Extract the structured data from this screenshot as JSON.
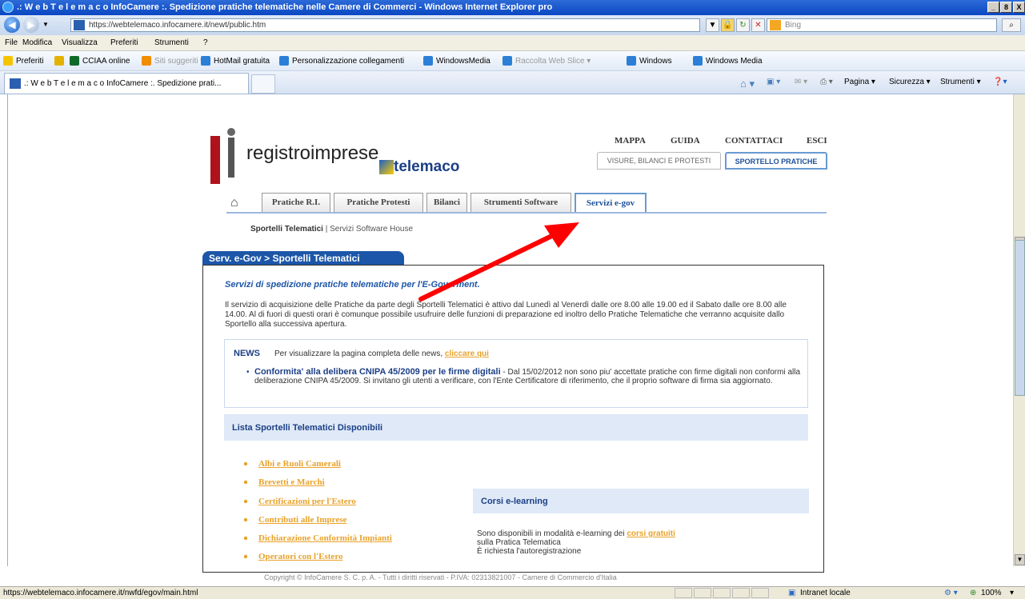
{
  "window": {
    "title": ".: W e b T e l e m a c o InfoCamere :. Spedizione pratiche telematiche nelle Camere di Commerci - Windows Internet Explorer pro",
    "min": "_",
    "max": "8",
    "close": "X"
  },
  "address": {
    "url": "https://webtelemaco.infocamere.it/newt/public.htm",
    "search_placeholder": "Bing"
  },
  "menu": {
    "file": "File",
    "edit": "Modifica",
    "view": "Visualizza",
    "favorites": "Preferiti",
    "tools": "Strumenti",
    "help": "?"
  },
  "favbar": {
    "favorites": "Preferiti",
    "items": [
      "CCIAA online",
      "Siti suggeriti ▾",
      "HotMail gratuita",
      "Personalizzazione collegamenti",
      "WindowsMedia",
      "Raccolta Web Slice ▾",
      "Windows",
      "Windows Media"
    ]
  },
  "tab": {
    "title": ".: W e b T e l e m a c o InfoCamere :. Spedizione prati..."
  },
  "commandbar": {
    "page": "Pagina ▾",
    "security": "Sicurezza ▾",
    "tools": "Strumenti ▾"
  },
  "brand": {
    "logo": "registroimprese",
    "sub": "telemaco"
  },
  "toplinks": [
    "MAPPA",
    "GUIDA",
    "CONTATTACI",
    "ESCI"
  ],
  "portal_buttons": [
    "VISURE, BILANCI E PROTESTI",
    "SPORTELLO PRATICHE"
  ],
  "nav_tabs": [
    "Pratiche R.I.",
    "Pratiche Protesti",
    "Bilanci",
    "Strumenti Software",
    "Servizi e-gov"
  ],
  "subnav": {
    "active": "Sportelli Telematici",
    "sep": " | ",
    "other": "Servizi Software House"
  },
  "panel": {
    "tab": "Serv. e-Gov > Sportelli Telematici",
    "title": "Servizi di spedizione pratiche telematiche per l'E-Goverment.",
    "body": "Il servizio di acquisizione delle Pratiche da parte degli Sportelli Telematici è attivo dal Lunedì al Venerdì dalle ore 8.00 alle 19.00 ed il Sabato dalle ore 8.00 alle 14.00. Al di fuori di questi orari è comunque possibile usufruire delle funzioni di preparazione ed inoltro dello Pratiche Telematiche che verranno acquisite dallo Sportello alla successiva apertura."
  },
  "news": {
    "label": "NEWS",
    "intro": "Per visualizzare la pagina completa delle news,",
    "link": "cliccare qui",
    "item_title": "Conformita' alla delibera CNIPA 45/2009 per le firme digitali",
    "item_text": " -  Dal 15/02/2012 non sono piu' accettate pratiche con firme digitali non conformi alla deliberazione CNIPA 45/2009. Si invitano gli utenti a verificare, con l'Ente Certificatore di riferimento, che il proprio software di firma sia aggiornato."
  },
  "list": {
    "header": "Lista Sportelli Telematici Disponibili",
    "items": [
      "Albi e Ruoli Camerali",
      "Brevetti e Marchi",
      "Certificazioni per l'Estero",
      "Contributi alle Imprese",
      "Dichiarazione Conformità Impianti",
      "Operatori con l'Estero"
    ]
  },
  "corsi": {
    "header": "Corsi e-learning",
    "line1": "Sono disponibili in modalità e-learning dei",
    "link": "corsi gratuiti",
    "line2": "sulla Pratica Telematica",
    "line3": "È richiesta l'autoregistrazione"
  },
  "footer": "Copyright © InfoCamere S. C. p. A. - Tutti i diritti riservati - P.IVA: 02313821007 - Camere di Commercio d'Italia",
  "status": {
    "url": "https://webtelemaco.infocamere.it/nwfd/egov/main.html",
    "zone": "Intranet locale",
    "zoom": "100%"
  },
  "colors": {
    "accent": "#1c56a8",
    "link": "#e8a22a",
    "arrow": "#ff0000"
  }
}
